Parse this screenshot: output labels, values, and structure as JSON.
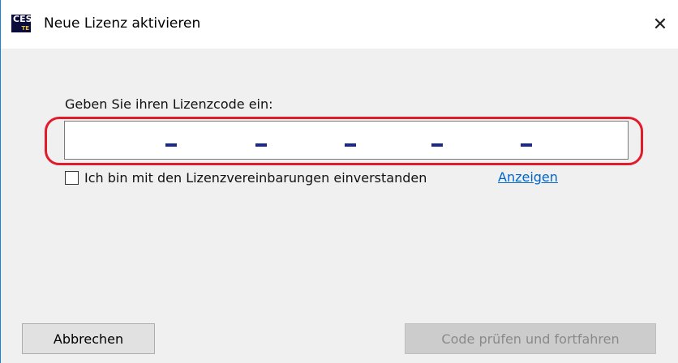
{
  "window": {
    "title": "Neue Lizenz aktivieren",
    "app_icon_text": "CES",
    "app_icon_subtext": "TE",
    "close_glyph": "✕"
  },
  "form": {
    "prompt": "Geben Sie ihren Lizenzcode ein:",
    "code_segments": [
      "",
      "",
      "",
      "",
      "",
      ""
    ],
    "separator_count": 5,
    "agreement_label": "Ich bin mit den Lizenzvereinbarungen einverstanden",
    "agreement_checked": false,
    "show_link": "Anzeigen"
  },
  "buttons": {
    "cancel": "Abbrechen",
    "continue": "Code prüfen und fortfahren",
    "continue_enabled": false
  },
  "colors": {
    "highlight": "#e11b2a",
    "dash": "#1a2a8c",
    "link": "#0066cc",
    "window_border": "#1883d7"
  },
  "icons": {
    "close": "close-icon",
    "app": "app-logo-icon"
  }
}
